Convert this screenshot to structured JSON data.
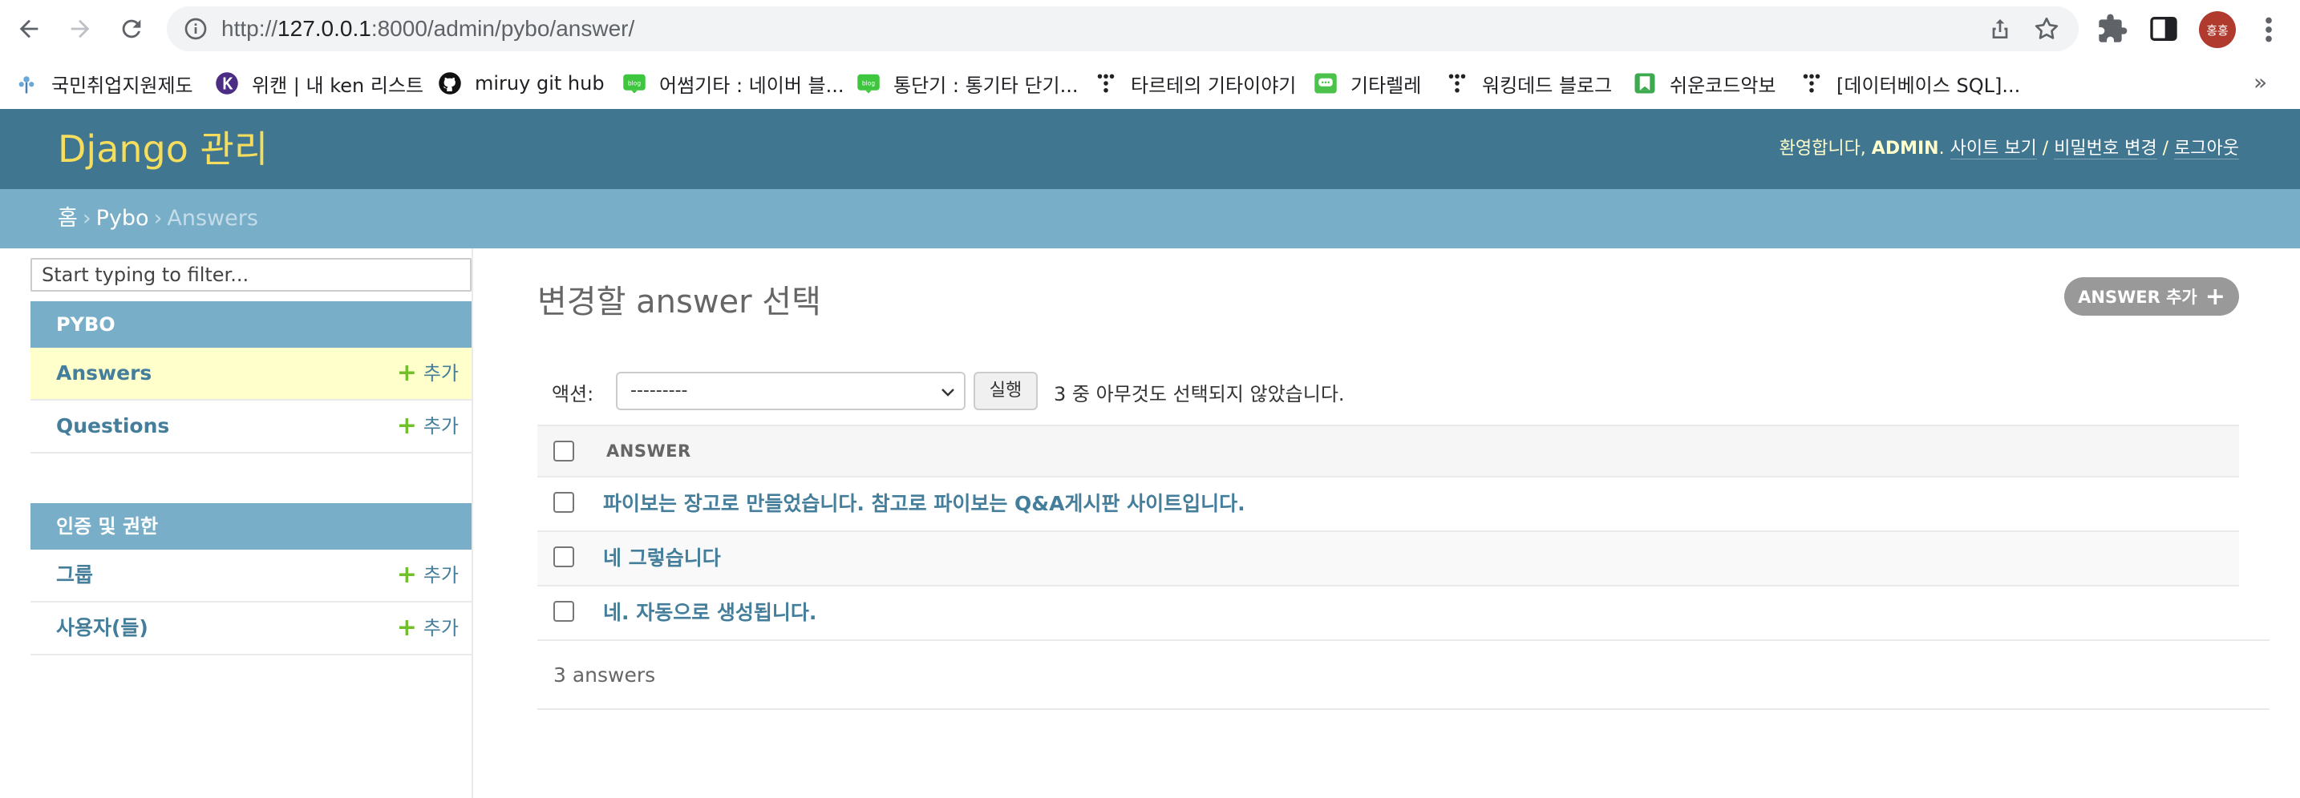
{
  "browser": {
    "url_prefix": "http://",
    "url_host": "127.0.0.1",
    "url_rest": ":8000/admin/pybo/answer/",
    "profile_label": "홍홍",
    "bookmarks": [
      {
        "label": "국민취업지원제도",
        "icon": "flower-icon"
      },
      {
        "label": "위캔 | 내 ken 리스트",
        "icon": "k-letter-icon"
      },
      {
        "label": "miruy git hub",
        "icon": "github-icon"
      },
      {
        "label": "어썸기타 : 네이버 블...",
        "icon": "naver-blog-icon"
      },
      {
        "label": "통단기 : 통기타 단기...",
        "icon": "naver-blog-icon"
      },
      {
        "label": "타르테의 기타이야기",
        "icon": "tistory-icon"
      },
      {
        "label": "기타렐레",
        "icon": "chat-icon"
      },
      {
        "label": "워킹데드 블로그",
        "icon": "tistory-icon"
      },
      {
        "label": "쉬운코드악보",
        "icon": "bookmark-green-icon"
      },
      {
        "label": "[데이터베이스 SQL]...",
        "icon": "tistory-icon"
      }
    ],
    "bookmarks_more": "»"
  },
  "header": {
    "branding": "Django 관리",
    "welcome": "환영합니다, ",
    "username": "ADMIN",
    "after_username": ". ",
    "view_site": "사이트 보기",
    "sep1": " / ",
    "change_password": "비밀번호 변경",
    "sep2": " / ",
    "logout": "로그아웃"
  },
  "breadcrumbs": {
    "home": "홈",
    "sep": "›",
    "app": "Pybo",
    "current": "Answers"
  },
  "sidebar": {
    "filter_placeholder": "Start typing to filter...",
    "modules": [
      {
        "caption": "PYBO",
        "models": [
          {
            "name": "Answers",
            "add": "추가",
            "current": true
          },
          {
            "name": "Questions",
            "add": "추가",
            "current": false
          }
        ]
      },
      {
        "caption": "인증 및 권한",
        "models": [
          {
            "name": "그룹",
            "add": "추가",
            "current": false
          },
          {
            "name": "사용자(들)",
            "add": "추가",
            "current": false
          }
        ]
      }
    ]
  },
  "content": {
    "title": "변경할 answer 선택",
    "add_button": "ANSWER 추가",
    "actions_label": "액션:",
    "actions_selected": "---------",
    "go_button": "실행",
    "action_counter": "3 중 아무것도 선택되지 않았습니다.",
    "column_header": "ANSWER",
    "rows": [
      "파이보는 장고로 만들었습니다. 참고로 파이보는 Q&A게시판 사이트입니다.",
      "네 그렇습니다",
      "네. 자동으로 생성됩니다."
    ],
    "paginator": "3 answers"
  },
  "colors": {
    "header_bg": "#417690",
    "branding": "#f5dd5d",
    "breadcrumbs_bg": "#79aec8",
    "link": "#447e9b",
    "add_green": "#70bf2b",
    "current_row": "#ffffcc"
  }
}
